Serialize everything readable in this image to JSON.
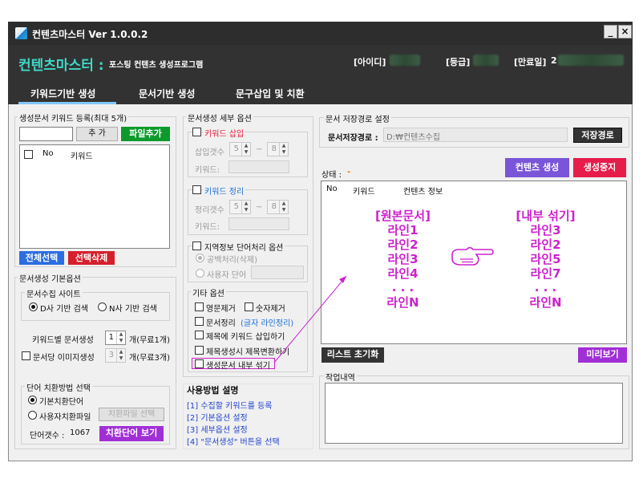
{
  "window": {
    "title": "컨텐츠마스터  Ver 1.0.0.2",
    "minimize": "_",
    "close": "×"
  },
  "header": {
    "app_title": "컨텐츠마스터 :",
    "subtitle": "포스팅 컨텐츠 생성프로그램",
    "id_label": "[아이디]",
    "grade_label": "[등급]",
    "expire_label": "[만료일]",
    "expire_prefix": "2"
  },
  "tabs": [
    "키워드기반 생성",
    "문서기반 생성",
    "문구삽입 및 치환"
  ],
  "keyword_panel": {
    "title": "생성문서 키워드 등록(최대 5개)",
    "add_button": "추 가",
    "file_add_button": "파일추가",
    "col_no": "No",
    "col_keyword": "키워드",
    "select_all": "전체선택",
    "delete_selected": "선택삭제"
  },
  "basic_options": {
    "title": "문서생성 기본옵션",
    "site_group": "문서수집 사이트",
    "site_d": "D사 기반 검색",
    "site_n": "N사 기반 검색",
    "per_keyword_label": "키워드별 문서생성",
    "per_keyword_value": "1",
    "per_keyword_unit": "개(무료1개)",
    "images_label": "문서당 이미지생성",
    "images_value": "3",
    "images_unit": "개(무료3개)",
    "replace_group": "단어 치환방법 선택",
    "replace_default": "기본치환단어",
    "replace_user": "사용자치환파일",
    "replace_file_button": "치환파일 선택",
    "word_count_label": "단어갯수 :",
    "word_count_value": "1067",
    "view_words_button": "치환단어 보기"
  },
  "detail_options": {
    "title": "문서생성 세부 옵션",
    "keyword_insert": "키워드 삽입",
    "insert_count": "삽입갯수",
    "insert_min": "5",
    "insert_max": "8",
    "tilde": "~",
    "keyword_label": "키워드:",
    "keyword_cleanup": "키워드 정리",
    "cleanup_count": "정리갯수",
    "cleanup_min": "5",
    "cleanup_max": "8",
    "region_option": "지역정보 단어처리 옵션",
    "region_blank": "공백처리(삭제)",
    "region_user": "사용자 단어",
    "etc_title": "기타 옵션",
    "remove_english": "영문제거",
    "remove_numbers": "숫자제거",
    "doc_cleanup": "문서정리",
    "doc_cleanup_note": "(글자 라인정리)",
    "insert_keyword_title": "제목에 키워드 삽입하기",
    "convert_title": "제목생성시 제목변환하기",
    "shuffle_inside": "생성문서 내부 섞기"
  },
  "usage": {
    "title": "사용방법 설명",
    "steps": [
      "[1] 수집할 키워드를 등록",
      "[2] 기본옵션 설정",
      "[3] 세부옵션 설정",
      "[4] \"문서생성\" 버튼을 선택"
    ]
  },
  "save_path": {
    "group": "문서 저장경로 설정",
    "label": "문서저장경로 :",
    "value": "D:₩컨텐츠수집",
    "button": "저장경로"
  },
  "status": {
    "label": "상태 :",
    "value": "-",
    "create_button": "컨텐츠 생성",
    "stop_button": "생성중지",
    "col_no": "No",
    "col_keyword": "키워드",
    "col_info": "컨텐츠 정보",
    "reset_button": "리스트 초기화",
    "preview_button": "미리보기"
  },
  "illustration": {
    "left_title": "[원본문서]",
    "left_lines": [
      "라인1",
      "라인2",
      "라인3",
      "라인4"
    ],
    "right_title": "[내부 섞기]",
    "right_lines": [
      "라인3",
      "라인2",
      "라인5",
      "라인7"
    ],
    "dots": ". . .",
    "left_last": "라인N",
    "right_last": "라인N",
    "accent_color": "#cc22cc"
  },
  "log": {
    "title": "작업내역"
  }
}
